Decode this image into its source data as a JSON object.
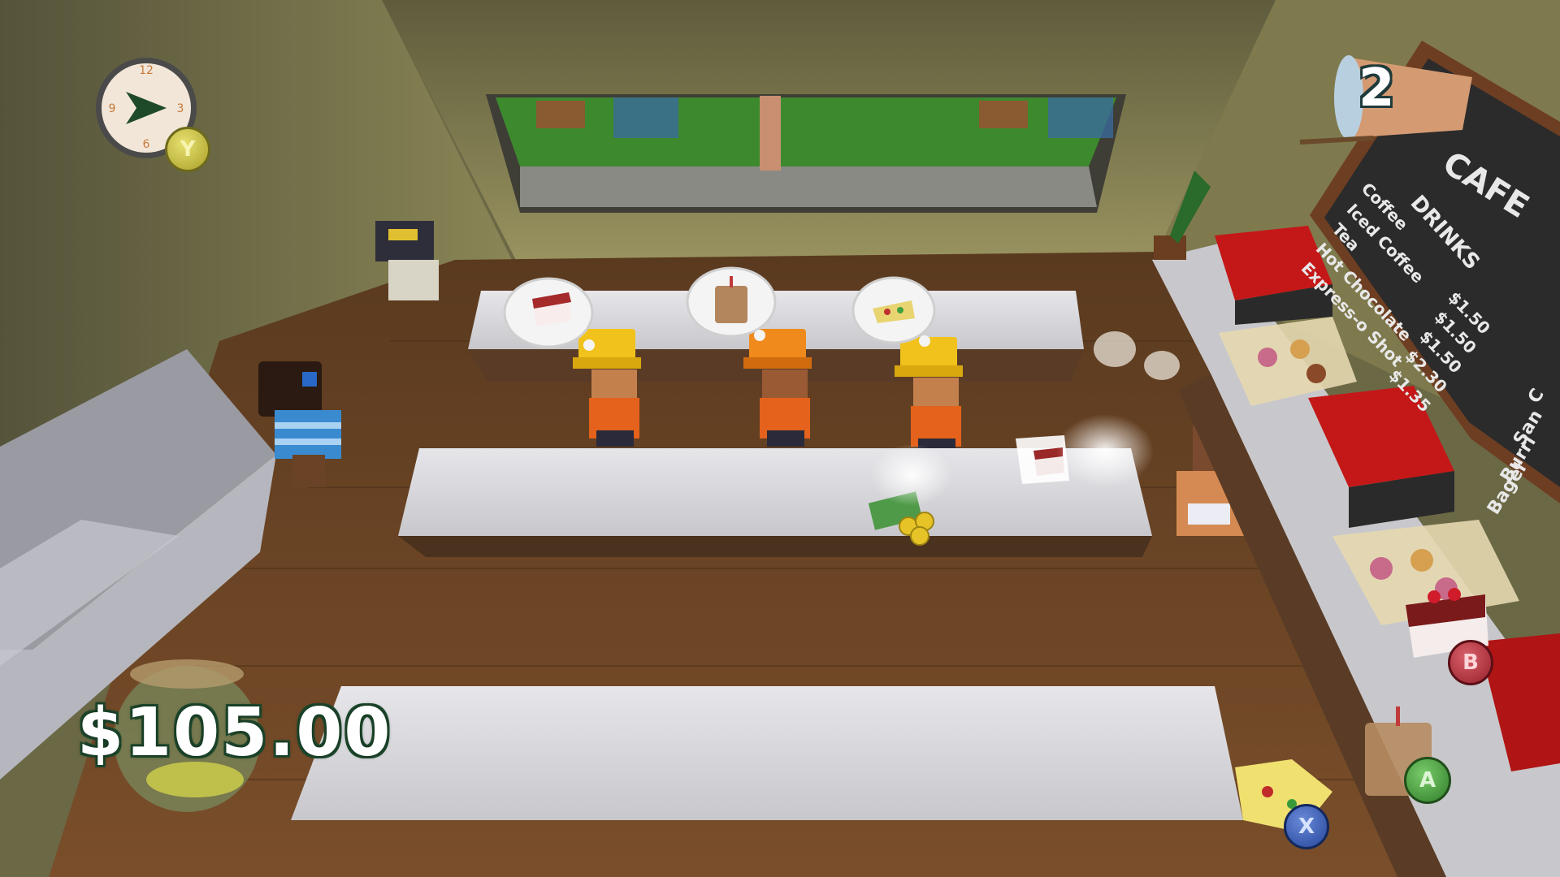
{
  "hud": {
    "money": "$105.00",
    "cups_remaining": "2",
    "clock_icon": "clock-fast-forward-icon"
  },
  "buttons": {
    "y": "Y",
    "b": "B",
    "a": "A",
    "x": "X"
  },
  "menu_board": {
    "title": "CAFE",
    "section": "DRINKS",
    "items": [
      {
        "name": "Coffee",
        "price": "$1.50"
      },
      {
        "name": "Iced Coffee",
        "price": "$1.50"
      },
      {
        "name": "Tea",
        "price": "$1.50"
      },
      {
        "name": "Hot Chocolate",
        "price": "$2.30"
      },
      {
        "name": "Express-o Shot",
        "price": "$1.35"
      }
    ],
    "side_items": [
      "C",
      "San",
      "Burri",
      "Bagel"
    ]
  },
  "orders": [
    {
      "item": "cake",
      "icon": "cake-slice-icon"
    },
    {
      "item": "iced-coffee",
      "icon": "iced-coffee-icon"
    },
    {
      "item": "burrito",
      "icon": "burrito-icon"
    }
  ],
  "colors": {
    "money_outline": "#1f4a2e",
    "board": "#2b2b2b",
    "counter": "#d8d8dc",
    "floor": "#6a4326"
  }
}
